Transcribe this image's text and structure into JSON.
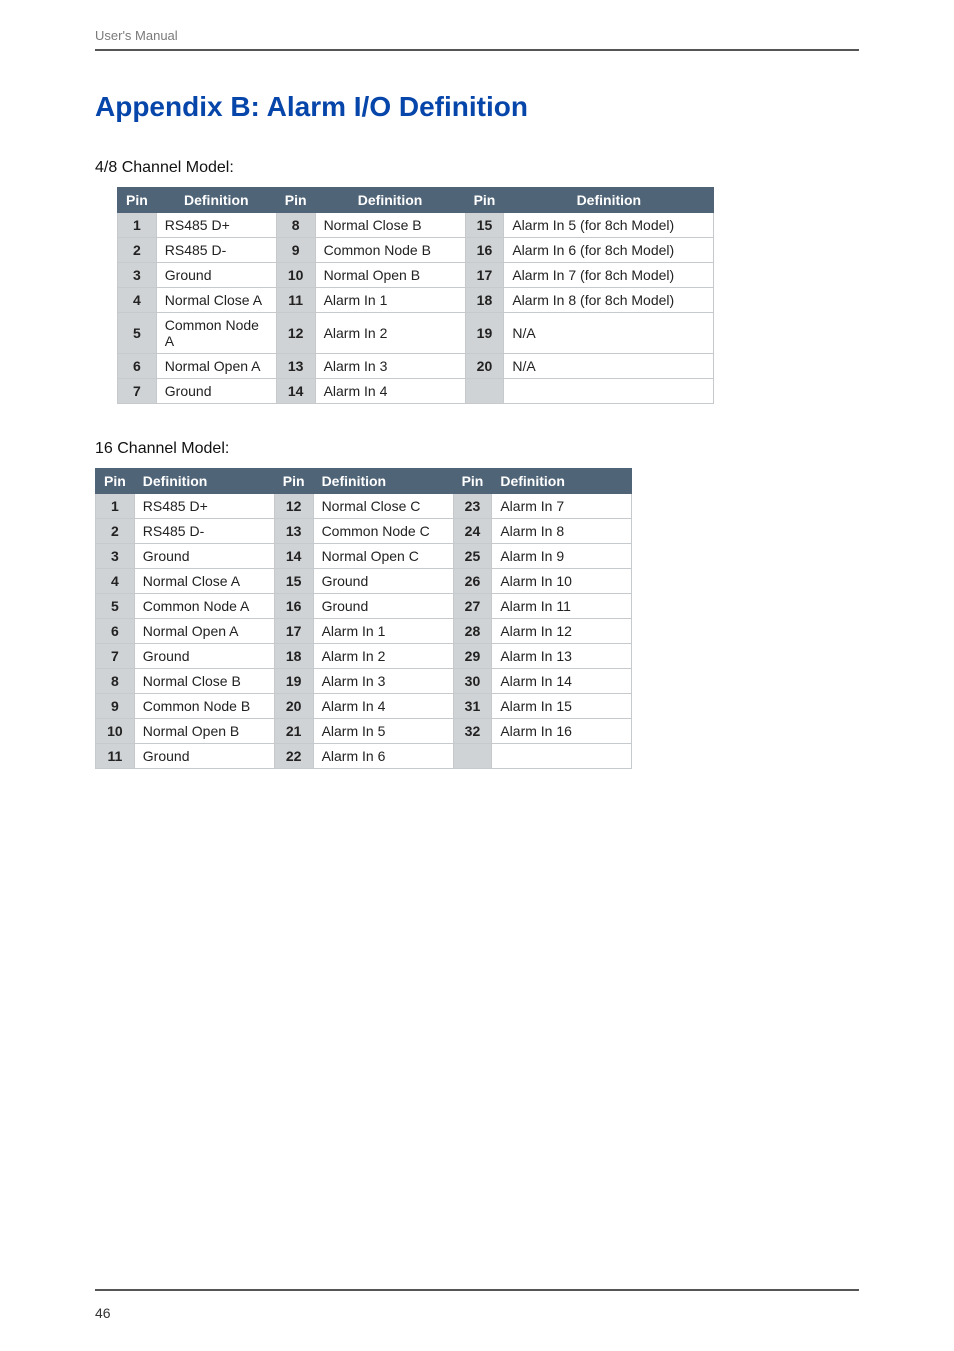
{
  "header": {
    "text": "User's Manual"
  },
  "title": "Appendix B: Alarm I/O Definition",
  "section1": {
    "heading": "4/8 Channel Model:",
    "cols": [
      "Pin",
      "Definition",
      "Pin",
      "Definition",
      "Pin",
      "Definition"
    ],
    "rows": [
      {
        "p1": "1",
        "d1": "RS485 D+",
        "p2": "8",
        "d2": "Normal Close B",
        "p3": "15",
        "d3": "Alarm In 5 (for 8ch Model)"
      },
      {
        "p1": "2",
        "d1": "RS485 D-",
        "p2": "9",
        "d2": "Common Node B",
        "p3": "16",
        "d3": "Alarm In 6 (for 8ch Model)"
      },
      {
        "p1": "3",
        "d1": "Ground",
        "p2": "10",
        "d2": "Normal Open B",
        "p3": "17",
        "d3": "Alarm In 7 (for 8ch Model)"
      },
      {
        "p1": "4",
        "d1": "Normal Close A",
        "p2": "11",
        "d2": "Alarm In 1",
        "p3": "18",
        "d3": "Alarm In 8 (for 8ch Model)"
      },
      {
        "p1": "5",
        "d1": "Common Node A",
        "p2": "12",
        "d2": "Alarm In 2",
        "p3": "19",
        "d3": "N/A"
      },
      {
        "p1": "6",
        "d1": "Normal Open A",
        "p2": "13",
        "d2": "Alarm In 3",
        "p3": "20",
        "d3": "N/A"
      },
      {
        "p1": "7",
        "d1": "Ground",
        "p2": "14",
        "d2": "Alarm In 4",
        "p3": "",
        "d3": ""
      }
    ]
  },
  "section2": {
    "heading": "16 Channel Model:",
    "cols": [
      "Pin",
      "Definition",
      "Pin",
      "Definition",
      "Pin",
      "Definition"
    ],
    "rows": [
      {
        "p1": "1",
        "d1": "RS485 D+",
        "p2": "12",
        "d2": "Normal Close C",
        "p3": "23",
        "d3": "Alarm In 7"
      },
      {
        "p1": "2",
        "d1": "RS485 D-",
        "p2": "13",
        "d2": "Common Node C",
        "p3": "24",
        "d3": "Alarm In 8"
      },
      {
        "p1": "3",
        "d1": "Ground",
        "p2": "14",
        "d2": "Normal Open C",
        "p3": "25",
        "d3": "Alarm In 9"
      },
      {
        "p1": "4",
        "d1": "Normal Close A",
        "p2": "15",
        "d2": "Ground",
        "p3": "26",
        "d3": "Alarm In 10"
      },
      {
        "p1": "5",
        "d1": "Common Node A",
        "p2": "16",
        "d2": "Ground",
        "p3": "27",
        "d3": "Alarm In 11"
      },
      {
        "p1": "6",
        "d1": "Normal Open A",
        "p2": "17",
        "d2": "Alarm In 1",
        "p3": "28",
        "d3": "Alarm In 12"
      },
      {
        "p1": "7",
        "d1": "Ground",
        "p2": "18",
        "d2": "Alarm In 2",
        "p3": "29",
        "d3": "Alarm In 13"
      },
      {
        "p1": "8",
        "d1": "Normal Close B",
        "p2": "19",
        "d2": "Alarm In 3",
        "p3": "30",
        "d3": "Alarm In 14"
      },
      {
        "p1": "9",
        "d1": "Common Node B",
        "p2": "20",
        "d2": "Alarm In 4",
        "p3": "31",
        "d3": "Alarm In 15"
      },
      {
        "p1": "10",
        "d1": "Normal Open B",
        "p2": "21",
        "d2": "Alarm In 5",
        "p3": "32",
        "d3": "Alarm In 16"
      },
      {
        "p1": "11",
        "d1": "Ground",
        "p2": "22",
        "d2": "Alarm In 6",
        "p3": "",
        "d3": ""
      }
    ]
  },
  "footer": {
    "page": "46"
  }
}
